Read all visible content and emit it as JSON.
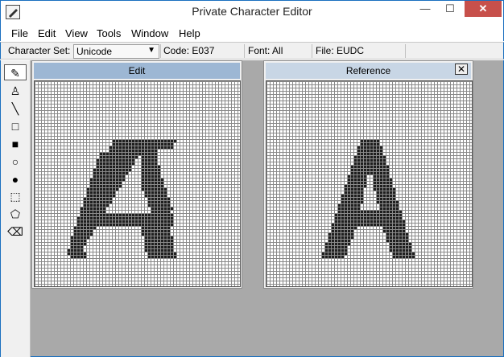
{
  "window": {
    "title": "Private Character Editor",
    "minimize": "—",
    "maximize": "☐",
    "close": "✕"
  },
  "menu": {
    "file": "File",
    "edit": "Edit",
    "view": "View",
    "tools": "Tools",
    "window": "Window",
    "help": "Help"
  },
  "info": {
    "charset_label": "Character Set:",
    "charset_value": "Unicode",
    "code": "Code: E037",
    "font": "Font: All",
    "file": "File: EUDC"
  },
  "tools": [
    {
      "name": "pencil-tool",
      "glyph": "✎"
    },
    {
      "name": "brush-tool",
      "glyph": "♙"
    },
    {
      "name": "line-tool",
      "glyph": "╲"
    },
    {
      "name": "hollow-rectangle-tool",
      "glyph": "□"
    },
    {
      "name": "filled-rectangle-tool",
      "glyph": "■"
    },
    {
      "name": "hollow-ellipse-tool",
      "glyph": "○"
    },
    {
      "name": "filled-ellipse-tool",
      "glyph": "●"
    },
    {
      "name": "rectangular-selection-tool",
      "glyph": "⬚"
    },
    {
      "name": "freeform-selection-tool",
      "glyph": "⬠"
    },
    {
      "name": "eraser-tool",
      "glyph": "⌫"
    }
  ],
  "edit_window": {
    "title": "Edit"
  },
  "reference_window": {
    "title": "Reference",
    "close": "✕"
  },
  "colors": {
    "active_title": "#9db7d4",
    "inactive_title": "#c8d6e5",
    "mdi_bg": "#a9a9a9",
    "glyph": "#1e1e1e"
  },
  "glyphs": {
    "edit_A": {
      "cells": "font-private-char-A-with-top-bar",
      "shown_in": "edit-grid"
    },
    "ref_A": {
      "cells": "reference-A",
      "shown_in": "reference-grid"
    }
  }
}
